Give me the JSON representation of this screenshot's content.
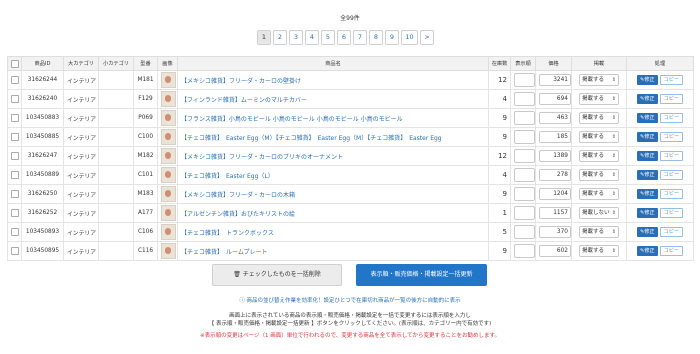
{
  "total_count": "全99件",
  "pagination": [
    "1",
    "2",
    "3",
    "4",
    "5",
    "6",
    "7",
    "8",
    "9",
    "10",
    ">"
  ],
  "columns": [
    "",
    "商品ID",
    "大カテゴリ",
    "小カテゴリ",
    "型番",
    "画像",
    "商品名",
    "在庫数",
    "表示順",
    "価格",
    "掲載",
    "処理"
  ],
  "rows": [
    {
      "id": "31626244",
      "cat": "インテリア",
      "sub": "",
      "model": "M181",
      "name": "【メキシコ雑貨】フリーダ・カーロの壁掛け",
      "stock": "12",
      "price": "3241",
      "publish": "掲載する"
    },
    {
      "id": "31626240",
      "cat": "インテリア",
      "sub": "",
      "model": "F129",
      "name": "【フィンランド雑貨】ムーミンのマルチカバー",
      "stock": "4",
      "price": "694",
      "publish": "掲載する"
    },
    {
      "id": "103450883",
      "cat": "インテリア",
      "sub": "",
      "model": "P069",
      "name": "【フランス雑貨】小鳥のモビール 小鳥のモビール 小鳥のモビール 小鳥のモビール",
      "stock": "9",
      "price": "463",
      "publish": "掲載する"
    },
    {
      "id": "103450885",
      "cat": "インテリア",
      "sub": "",
      "model": "C100",
      "name": "【チェコ雑貨】　Easter Egg（M）【チェコ雑貨】　Easter Egg（M）【チェコ雑貨】　Easter Egg",
      "stock": "9",
      "price": "185",
      "publish": "掲載する"
    },
    {
      "id": "31626247",
      "cat": "インテリア",
      "sub": "",
      "model": "M182",
      "name": "【メキシコ雑貨】フリーダ・カーロのブリキのオーナメント",
      "stock": "12",
      "price": "1389",
      "publish": "掲載する"
    },
    {
      "id": "103450889",
      "cat": "インテリア",
      "sub": "",
      "model": "C101",
      "name": "【チェコ雑貨】　Easter Egg（L）",
      "stock": "4",
      "price": "278",
      "publish": "掲載する"
    },
    {
      "id": "31626250",
      "cat": "インテリア",
      "sub": "",
      "model": "M183",
      "name": "【メキシコ雑貨】フリーダ・カーロの木箱",
      "stock": "9",
      "price": "1204",
      "publish": "掲載する"
    },
    {
      "id": "31626252",
      "cat": "インテリア",
      "sub": "",
      "model": "A177",
      "name": "【アルゼンチン雑貨】おびたキリストの絵",
      "stock": "1",
      "price": "1157",
      "publish": "掲載しない"
    },
    {
      "id": "103450893",
      "cat": "インテリア",
      "sub": "",
      "model": "C106",
      "name": "【チェコ雑貨】　トランクボックス",
      "stock": "5",
      "price": "370",
      "publish": "掲載する"
    },
    {
      "id": "103450895",
      "cat": "インテリア",
      "sub": "",
      "model": "C116",
      "name": "【チェコ雑貨】　ルームプレート",
      "stock": "9",
      "price": "602",
      "publish": "掲載する"
    }
  ],
  "buttons": {
    "edit": "修正",
    "copy": "コピー",
    "delete": "チェックしたものを一括削除",
    "update": "表示順・販売価格・掲載設定一括更新"
  },
  "notes": {
    "info": "ⓘ 商品の並び替え作業を効率化！設定ひとつで在庫切れ商品が一覧の後方に自動的に表示",
    "line1": "画面上に表示されている商品の表示順・販売価格・掲載設定を一括で変更するには表示順を入力し",
    "line2": "【 表示順・販売価格・掲載設定一括更新 】ボタンをクリックしてください。(表示順は、カテゴリー内で有効です)",
    "warn": "※表示順の変更はページ（1 画面）単位で行われるので、変更する商品を全て表示してから変更することをお勧めします。"
  }
}
